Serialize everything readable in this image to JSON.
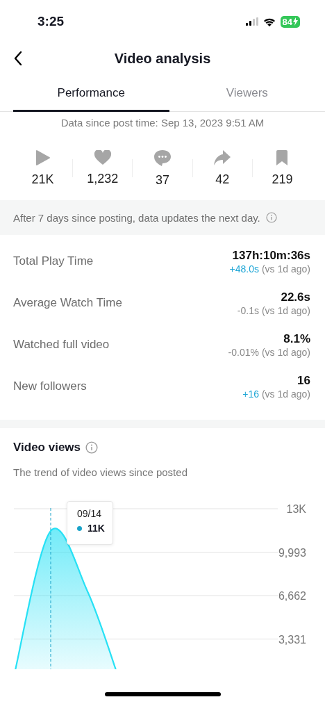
{
  "status_bar": {
    "time": "3:25",
    "battery": "84",
    "charging": true
  },
  "header": {
    "title": "Video analysis"
  },
  "tabs": [
    {
      "label": "Performance",
      "selected": true
    },
    {
      "label": "Viewers",
      "selected": false
    }
  ],
  "since": "Data since post time: Sep 13, 2023 9:51 AM",
  "stats": [
    {
      "kind": "plays",
      "value": "21K"
    },
    {
      "kind": "likes",
      "value": "1,232"
    },
    {
      "kind": "comments",
      "value": "37"
    },
    {
      "kind": "shares",
      "value": "42"
    },
    {
      "kind": "saves",
      "value": "219"
    }
  ],
  "note": "After 7 days since posting, data updates the next day.",
  "metrics": [
    {
      "label": "Total Play Time",
      "value": "137h:10m:36s",
      "change": "+48.0s",
      "compare": "(vs 1d ago)",
      "positive": true
    },
    {
      "label": "Average Watch Time",
      "value": "22.6s",
      "change": "-0.1s",
      "compare": "(vs 1d ago)",
      "positive": false
    },
    {
      "label": "Watched full video",
      "value": "8.1%",
      "change": "-0.01%",
      "compare": "(vs 1d ago)",
      "positive": false
    },
    {
      "label": "New followers",
      "value": "16",
      "change": "+16",
      "compare": "(vs 1d ago)",
      "positive": true
    }
  ],
  "views": {
    "title": "Video views",
    "subtitle": "The trend of video views since posted",
    "tooltip": {
      "date": "09/14",
      "value": "11K"
    },
    "axis_labels": [
      "13K",
      "9,993",
      "6,662",
      "3,331"
    ]
  }
}
